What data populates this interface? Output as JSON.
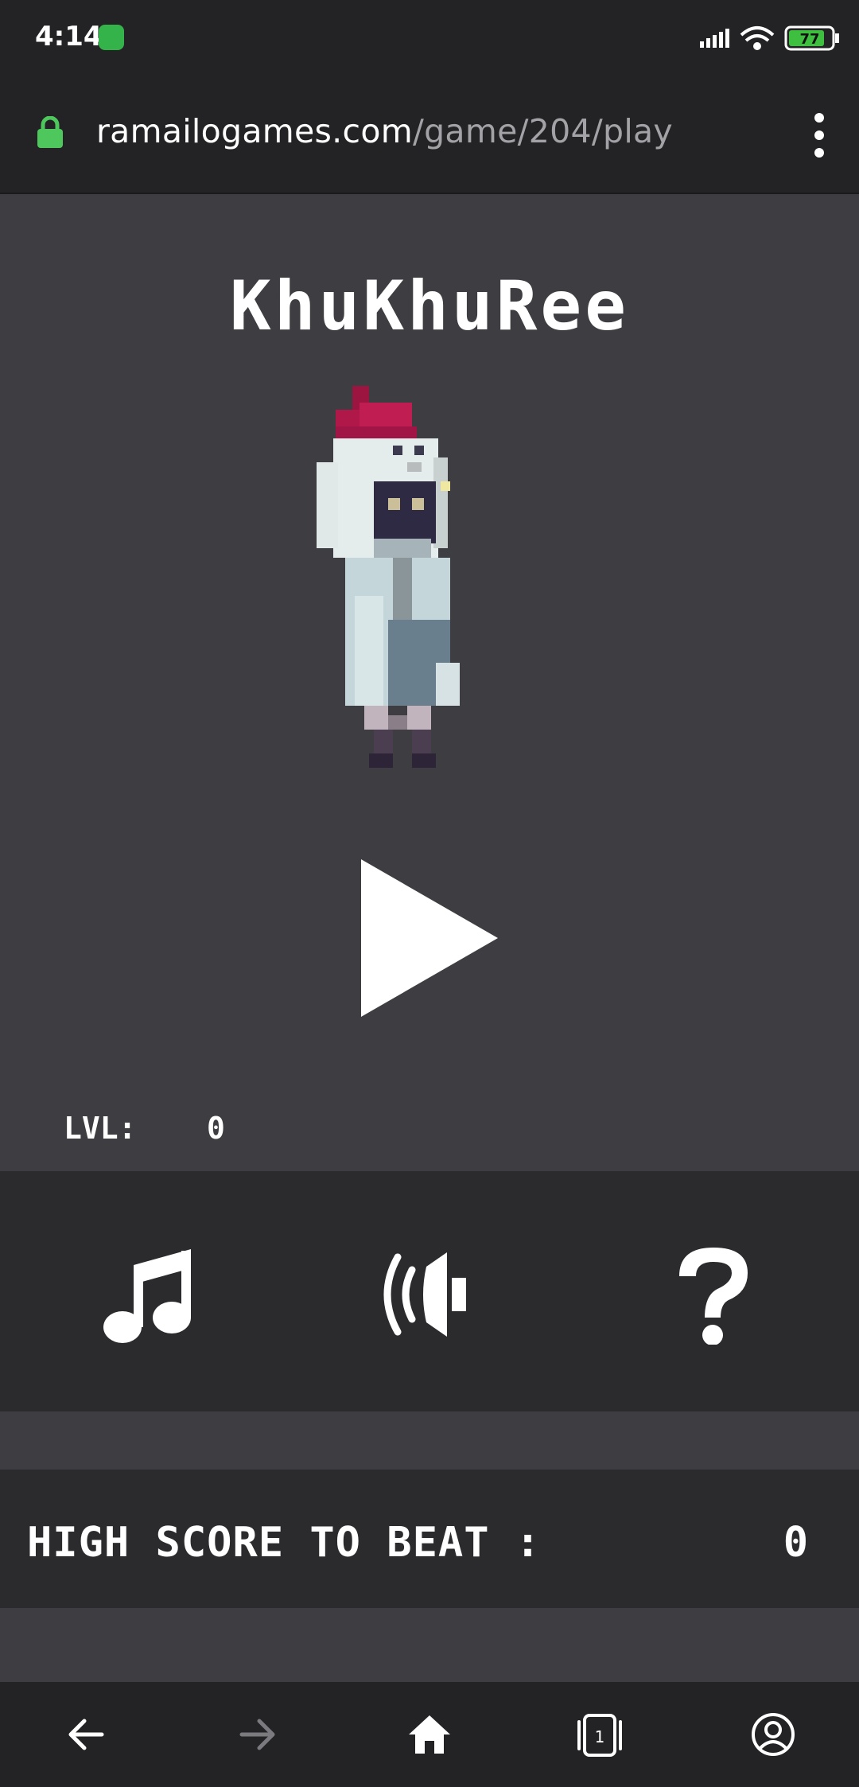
{
  "status": {
    "time": "4:14",
    "battery": "77"
  },
  "browser": {
    "url_domain": "ramailogames.com",
    "url_path": "/game/204/play",
    "tab_count": "1"
  },
  "game": {
    "title": "KhuKhuRee",
    "level_label": "LVL:",
    "level_value": "0",
    "high_score_label": "HIGH SCORE TO BEAT :",
    "high_score_value": "0"
  },
  "icons": {
    "play": "play-icon",
    "music": "music-note-icon",
    "sound": "speaker-icon",
    "help": "question-mark-icon",
    "back": "back-arrow-icon",
    "forward": "forward-arrow-icon",
    "home": "home-icon",
    "tabs": "tabs-icon",
    "account": "account-icon"
  },
  "colors": {
    "background": "#3e3e42",
    "panel": "#2b2b2e",
    "bar": "#232325",
    "lock": "#4ec85c",
    "comb": "#b0184a"
  }
}
